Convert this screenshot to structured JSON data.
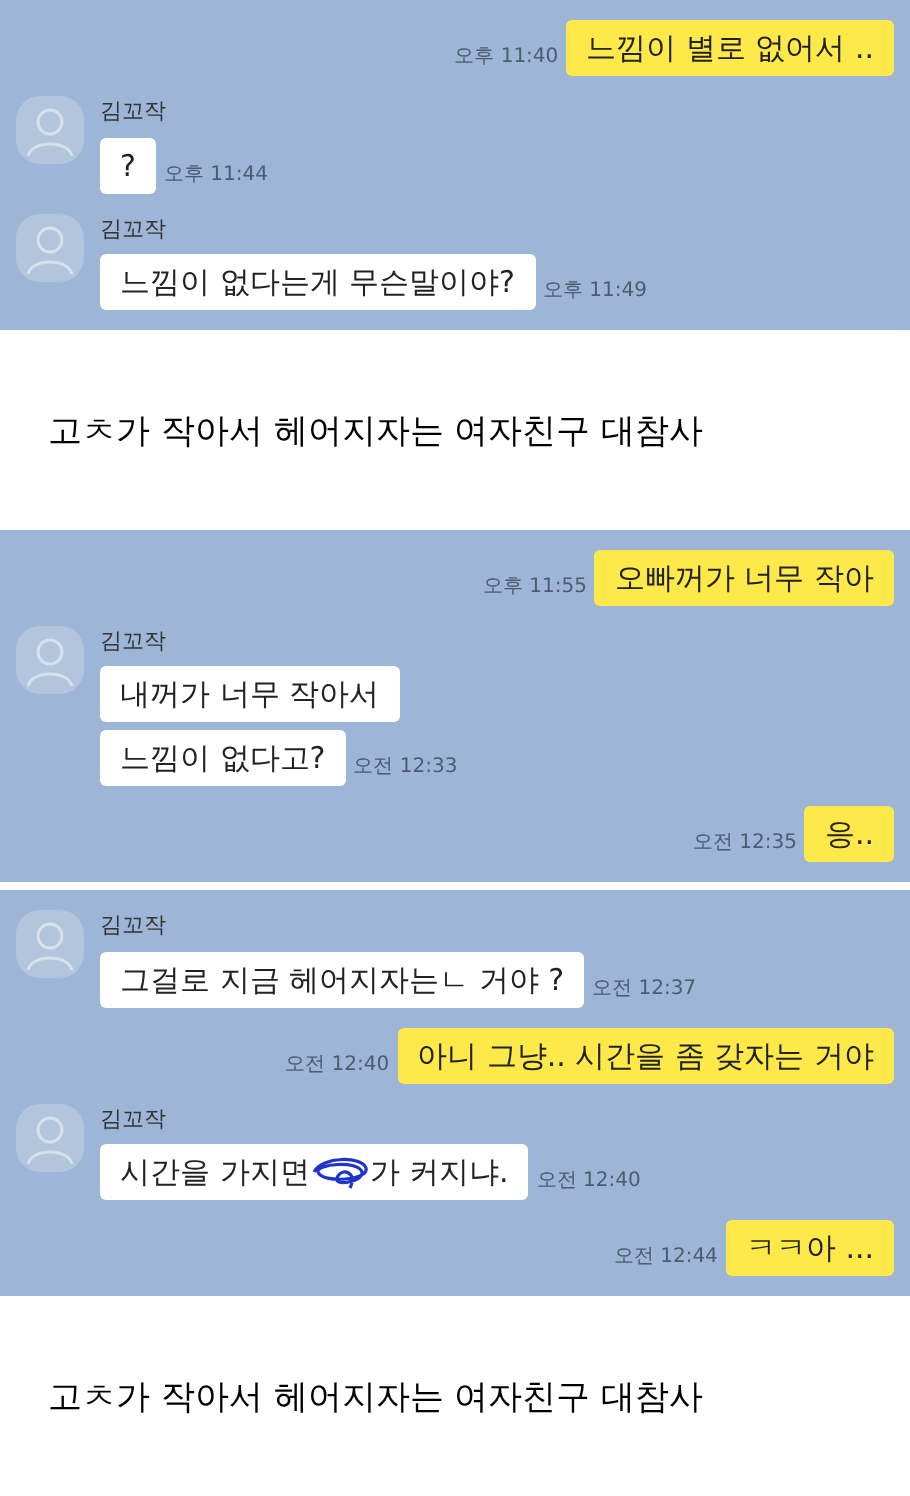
{
  "sections": [
    {
      "kind": "chat",
      "messages": [
        {
          "kind": "sent",
          "bubbles": [
            {
              "kind": "text",
              "text": "느낌이 별로 없어서 .."
            }
          ],
          "time": "오후 11:40"
        },
        {
          "kind": "received",
          "sender": "김꼬작",
          "bubbles": [
            {
              "kind": "text",
              "text": "?"
            }
          ],
          "time": "오후 11:44"
        },
        {
          "kind": "received",
          "sender": "김꼬작",
          "bubbles": [
            {
              "kind": "text",
              "text": "느낌이 없다는게 무슨말이야?"
            }
          ],
          "time": "오후 11:49"
        }
      ]
    },
    {
      "kind": "caption",
      "text": "고ㅊ가 작아서 헤어지자는 여자친구 대참사"
    },
    {
      "kind": "chat",
      "messages": [
        {
          "kind": "sent",
          "bubbles": [
            {
              "kind": "text",
              "text": "오빠꺼가 너무 작아"
            }
          ],
          "time": "오후 11:55"
        },
        {
          "kind": "received",
          "sender": "김꼬작",
          "bubbles": [
            {
              "kind": "text",
              "text": "내꺼가 너무 작아서"
            },
            {
              "kind": "text",
              "text": "느낌이 없다고?"
            }
          ],
          "time": "오전 12:33"
        },
        {
          "kind": "sent",
          "bubbles": [
            {
              "kind": "text",
              "text": "응.."
            }
          ],
          "time": "오전 12:35"
        }
      ]
    },
    {
      "kind": "chat",
      "messages": [
        {
          "kind": "received",
          "sender": "김꼬작",
          "bubbles": [
            {
              "kind": "text",
              "text": "그걸로 지금 헤어지자는ㄴ 거야 ?"
            }
          ],
          "time": "오전 12:37"
        },
        {
          "kind": "sent",
          "bubbles": [
            {
              "kind": "text",
              "text": "아니 그냥.. 시간을 좀 갖자는 거야"
            }
          ],
          "time": "오전 12:40"
        },
        {
          "kind": "received",
          "sender": "김꼬작",
          "bubbles": [
            {
              "kind": "scribbled",
              "before": "시간을 가지면",
              "after": "가 커지냐."
            }
          ],
          "time": "오전 12:40"
        },
        {
          "kind": "sent",
          "bubbles": [
            {
              "kind": "text",
              "text": "ㅋㅋ아 ..."
            }
          ],
          "time": "오전 12:44"
        }
      ]
    },
    {
      "kind": "caption",
      "text": "고ㅊ가 작아서 헤어지자는 여자친구 대참사"
    }
  ]
}
